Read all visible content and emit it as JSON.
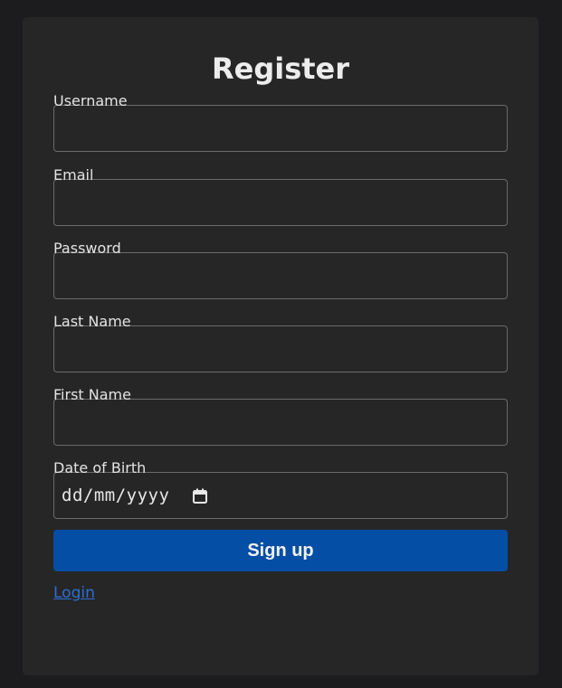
{
  "form": {
    "title": "Register",
    "fields": [
      {
        "label": "Username",
        "value": "",
        "placeholder": ""
      },
      {
        "label": "Email",
        "value": "",
        "placeholder": ""
      },
      {
        "label": "Password",
        "value": "",
        "placeholder": ""
      },
      {
        "label": "Last Name",
        "value": "",
        "placeholder": ""
      },
      {
        "label": "First Name",
        "value": "",
        "placeholder": ""
      },
      {
        "label": "Date of Birth",
        "value": "dd/mm/yyyy",
        "placeholder": "dd/mm/yyyy"
      }
    ],
    "submit_label": "Sign up",
    "login_link": "Login"
  },
  "colors": {
    "page_background": "#1c1c1e",
    "card_background": "#262626",
    "button_background": "#044ea5",
    "link": "#2f6fd3",
    "input_border": "#6b6b6b"
  },
  "icons": {
    "date_picker": "calendar-icon"
  }
}
